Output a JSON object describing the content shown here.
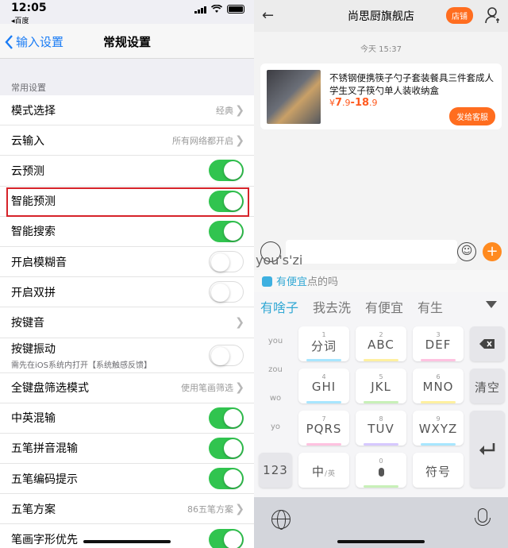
{
  "left": {
    "status": {
      "time": "12:05",
      "back_app": "◂百度"
    },
    "nav": {
      "back_label": "输入设置",
      "title": "常规设置"
    },
    "section_title": "常用设置",
    "rows": [
      {
        "label": "模式选择",
        "value": "经典",
        "chevron": true
      },
      {
        "label": "云输入",
        "value": "所有网络都开启",
        "chevron": true
      },
      {
        "label": "云预测",
        "toggle": "on"
      },
      {
        "label": "智能预测",
        "toggle": "on"
      },
      {
        "label": "智能搜索",
        "toggle": "on"
      },
      {
        "label": "开启模糊音",
        "toggle": "off"
      },
      {
        "label": "开启双拼",
        "toggle": "off"
      },
      {
        "label": "按键音",
        "chevron": true
      },
      {
        "label": "按键振动",
        "sub": "需先在iOS系统内打开【系统触感反馈】",
        "toggle": "off"
      },
      {
        "label": "全键盘筛选模式",
        "value": "使用笔画筛选",
        "chevron": true
      },
      {
        "label": "中英混输",
        "toggle": "on"
      },
      {
        "label": "五笔拼音混输",
        "toggle": "on"
      },
      {
        "label": "五笔编码提示",
        "toggle": "on"
      },
      {
        "label": "五笔方案",
        "value": "86五笔方案",
        "chevron": true
      },
      {
        "label": "笔画字形优先",
        "toggle": "on"
      }
    ]
  },
  "right": {
    "header": {
      "shop_name": "尚思厨旗舰店",
      "store_button": "店铺"
    },
    "time_tag": "今天 15:37",
    "product": {
      "title": "不锈钢便携筷子勺子套装餐具三件套成人学生叉子筷勺单人装收纳盒",
      "price_symbol": "¥",
      "price_low": "7",
      "price_low_dec": ".9",
      "price_sep": "-",
      "price_high": "18",
      "price_high_dec": ".9",
      "send_button": "发给客服"
    },
    "pinyin_input": "you's'zi",
    "association": {
      "highlight": "有便宜",
      "rest": "点的吗"
    },
    "candidates": [
      "有啥子",
      "我去洗",
      "有便宜",
      "有生"
    ],
    "side_column": [
      "you",
      "zou",
      "wo",
      "yo"
    ],
    "keys": [
      {
        "num": "1",
        "text": "分词"
      },
      {
        "num": "2",
        "text": "ABC"
      },
      {
        "num": "3",
        "text": "DEF"
      },
      {
        "num": "4",
        "text": "GHI"
      },
      {
        "num": "5",
        "text": "JKL"
      },
      {
        "num": "6",
        "text": "MNO"
      },
      {
        "num": "7",
        "text": "PQRS"
      },
      {
        "num": "8",
        "text": "TUV"
      },
      {
        "num": "9",
        "text": "WXYZ"
      }
    ],
    "key_clear": "清空",
    "key_123": "123",
    "key_lang": "中",
    "key_lang_sub": "/英",
    "key_zero": "0",
    "key_symbol": "符号"
  }
}
